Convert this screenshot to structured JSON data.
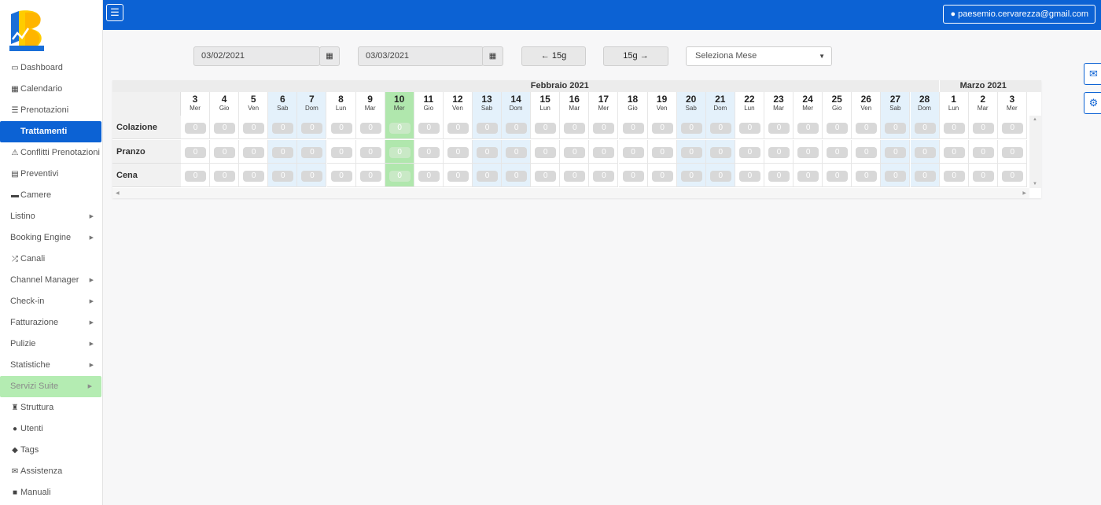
{
  "topbar": {
    "menu_icon": "hamburger-icon",
    "user_email": "paesemio.cervarezza@gmail.com"
  },
  "sidebar": {
    "items": [
      {
        "label": "Dashboard",
        "icon": "monitor-icon",
        "glyph": "▭"
      },
      {
        "label": "Calendario",
        "icon": "calendar-icon",
        "glyph": "▦"
      },
      {
        "label": "Prenotazioni",
        "icon": "list-icon",
        "glyph": "☰"
      },
      {
        "label": "Trattamenti",
        "icon": "apple-icon",
        "glyph": "",
        "active": true
      },
      {
        "label": "Conflitti Prenotazioni",
        "icon": "warning-icon",
        "glyph": "⚠"
      },
      {
        "label": "Preventivi",
        "icon": "calculator-icon",
        "glyph": "▤"
      },
      {
        "label": "Camere",
        "icon": "bed-icon",
        "glyph": "▬"
      },
      {
        "label": "Listino",
        "submenu": true
      },
      {
        "label": "Booking Engine",
        "submenu": true
      },
      {
        "label": "Canali",
        "icon": "shuffle-icon",
        "glyph": "⤮"
      },
      {
        "label": "Channel Manager",
        "submenu": true
      },
      {
        "label": "Check-in",
        "submenu": true
      },
      {
        "label": "Fatturazione",
        "submenu": true
      },
      {
        "label": "Pulizie",
        "submenu": true
      },
      {
        "label": "Statistiche",
        "submenu": true
      },
      {
        "label": "Servizi Suite",
        "submenu": true,
        "highlight": true
      },
      {
        "label": "Struttura",
        "icon": "building-icon",
        "glyph": "♜"
      },
      {
        "label": "Utenti",
        "icon": "user-icon",
        "glyph": "●"
      },
      {
        "label": "Tags",
        "icon": "tags-icon",
        "glyph": "◆"
      },
      {
        "label": "Assistenza",
        "icon": "envelope-icon",
        "glyph": "✉"
      },
      {
        "label": "Manuali",
        "icon": "book-icon",
        "glyph": "■"
      }
    ]
  },
  "filters": {
    "date_from": "03/02/2021",
    "date_to": "03/03/2021",
    "prev_label": "← 15g",
    "next_label": "15g →",
    "month_select": "Seleziona Mese"
  },
  "grid": {
    "months": [
      "Febbraio 2021",
      "Marzo 2021"
    ],
    "days": [
      {
        "n": "3",
        "d": "Mer"
      },
      {
        "n": "4",
        "d": "Gio"
      },
      {
        "n": "5",
        "d": "Ven"
      },
      {
        "n": "6",
        "d": "Sab",
        "we": true
      },
      {
        "n": "7",
        "d": "Dom",
        "we": true
      },
      {
        "n": "8",
        "d": "Lun"
      },
      {
        "n": "9",
        "d": "Mar"
      },
      {
        "n": "10",
        "d": "Mer",
        "today": true
      },
      {
        "n": "11",
        "d": "Gio"
      },
      {
        "n": "12",
        "d": "Ven"
      },
      {
        "n": "13",
        "d": "Sab",
        "we": true
      },
      {
        "n": "14",
        "d": "Dom",
        "we": true
      },
      {
        "n": "15",
        "d": "Lun"
      },
      {
        "n": "16",
        "d": "Mar"
      },
      {
        "n": "17",
        "d": "Mer"
      },
      {
        "n": "18",
        "d": "Gio"
      },
      {
        "n": "19",
        "d": "Ven"
      },
      {
        "n": "20",
        "d": "Sab",
        "we": true
      },
      {
        "n": "21",
        "d": "Dom",
        "we": true
      },
      {
        "n": "22",
        "d": "Lun"
      },
      {
        "n": "23",
        "d": "Mar"
      },
      {
        "n": "24",
        "d": "Mer"
      },
      {
        "n": "25",
        "d": "Gio"
      },
      {
        "n": "26",
        "d": "Ven"
      },
      {
        "n": "27",
        "d": "Sab",
        "we": true
      },
      {
        "n": "28",
        "d": "Dom",
        "we": true
      },
      {
        "n": "1",
        "d": "Lun"
      },
      {
        "n": "2",
        "d": "Mar"
      },
      {
        "n": "3",
        "d": "Mer"
      }
    ],
    "rows": [
      {
        "label": "Colazione",
        "values": [
          "0",
          "0",
          "0",
          "0",
          "0",
          "0",
          "0",
          "0",
          "0",
          "0",
          "0",
          "0",
          "0",
          "0",
          "0",
          "0",
          "0",
          "0",
          "0",
          "0",
          "0",
          "0",
          "0",
          "0",
          "0",
          "0",
          "0",
          "0",
          "0"
        ]
      },
      {
        "label": "Pranzo",
        "values": [
          "0",
          "0",
          "0",
          "0",
          "0",
          "0",
          "0",
          "0",
          "0",
          "0",
          "0",
          "0",
          "0",
          "0",
          "0",
          "0",
          "0",
          "0",
          "0",
          "0",
          "0",
          "0",
          "0",
          "0",
          "0",
          "0",
          "0",
          "0",
          "0"
        ]
      },
      {
        "label": "Cena",
        "values": [
          "0",
          "0",
          "0",
          "0",
          "0",
          "0",
          "0",
          "0",
          "0",
          "0",
          "0",
          "0",
          "0",
          "0",
          "0",
          "0",
          "0",
          "0",
          "0",
          "0",
          "0",
          "0",
          "0",
          "0",
          "0",
          "0",
          "0",
          "0",
          "0"
        ]
      }
    ]
  },
  "side_tools": [
    {
      "icon": "envelope-icon",
      "glyph": "✉"
    },
    {
      "icon": "gears-icon",
      "glyph": "⚙"
    }
  ],
  "colors": {
    "brand_blue": "#0c62d4",
    "weekend": "#e4f1fb",
    "today": "#b0e7ad",
    "suite_highlight": "#b4ecb2"
  }
}
